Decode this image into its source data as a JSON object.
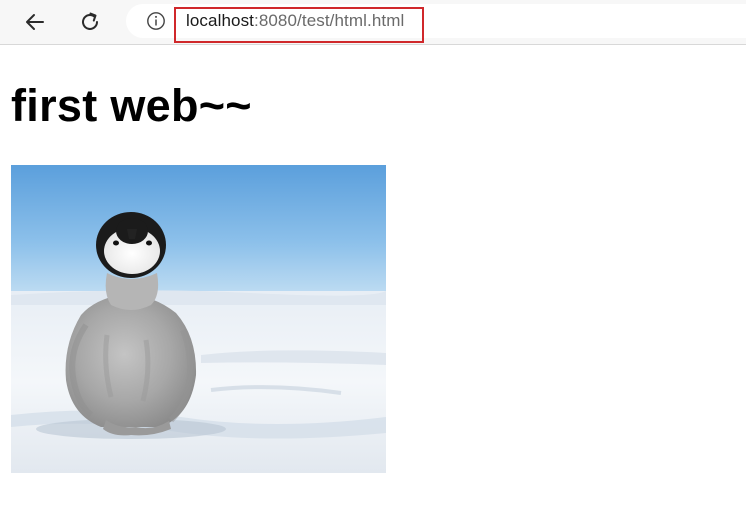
{
  "browser": {
    "back_icon": "arrow-left-icon",
    "refresh_icon": "refresh-icon",
    "info_icon": "info-icon",
    "url_host": "localhost",
    "url_rest": ":8080/test/html.html",
    "highlight_color": "#d0282b"
  },
  "page": {
    "heading": "first web~~",
    "image_subject": "baby-penguin-on-snow"
  }
}
